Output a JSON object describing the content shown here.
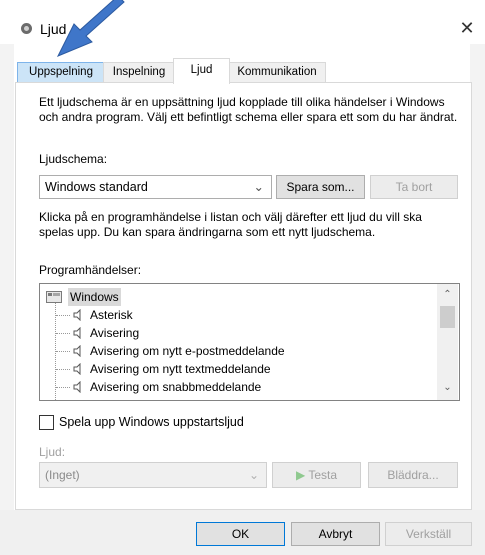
{
  "window": {
    "title": "Ljud",
    "close_glyph": "✕"
  },
  "tabs": [
    {
      "label": "Uppspelning"
    },
    {
      "label": "Inspelning"
    },
    {
      "label": "Ljud"
    },
    {
      "label": "Kommunikation"
    }
  ],
  "sounds": {
    "description": "Ett ljudschema är en uppsättning ljud kopplade till olika händelser i Windows och andra program. Välj ett befintligt schema eller spara ett som du har ändrat.",
    "scheme_label": "Ljudschema:",
    "scheme_value": "Windows standard",
    "save_as_label": "Spara som...",
    "delete_label": "Ta bort",
    "hint": "Klicka på en programhändelse i listan och välj därefter ett ljud du vill ska spelas upp. Du kan spara ändringarna som ett nytt ljudschema.",
    "events_label": "Programhändelser:",
    "events_root": "Windows",
    "events": [
      {
        "label": "Asterisk"
      },
      {
        "label": "Avisering"
      },
      {
        "label": "Avisering om nytt e-postmeddelande"
      },
      {
        "label": "Avisering om nytt textmeddelande"
      },
      {
        "label": "Avisering om snabbmeddelande"
      }
    ],
    "startup_label": "Spela upp Windows uppstartsljud",
    "startup_checked": false,
    "sound_label": "Ljud:",
    "sound_value": "(Inget)",
    "test_label": "Testa",
    "browse_label": "Bläddra..."
  },
  "footer": {
    "ok_label": "OK",
    "cancel_label": "Avbryt",
    "apply_label": "Verkställ"
  },
  "colors": {
    "selected_tab": "#cce4f7",
    "arrow": "#3f76c9"
  }
}
